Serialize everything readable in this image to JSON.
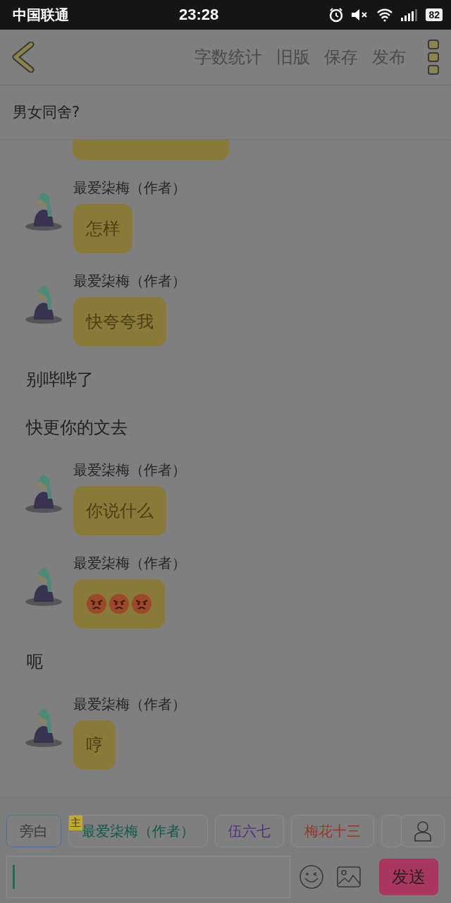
{
  "status_bar": {
    "carrier": "中国联通",
    "time": "23:28",
    "battery": "82"
  },
  "toolbar": {
    "actions": [
      "字数统计",
      "旧版",
      "保存",
      "发布"
    ]
  },
  "chapter_title": "男女同舍?",
  "messages": [
    {
      "kind": "partial"
    },
    {
      "kind": "author",
      "name": "最爱柒梅（作者）",
      "text": "怎样"
    },
    {
      "kind": "author",
      "name": "最爱柒梅（作者）",
      "text": "快夸夸我"
    },
    {
      "kind": "narration",
      "text": "别哔哔了"
    },
    {
      "kind": "narration",
      "text": "快更你的文去"
    },
    {
      "kind": "author",
      "name": "最爱柒梅（作者）",
      "text": "你说什么"
    },
    {
      "kind": "emoji",
      "name": "最爱柒梅（作者）"
    },
    {
      "kind": "narration",
      "text": "呃"
    },
    {
      "kind": "author",
      "name": "最爱柒梅（作者）",
      "text": "哼"
    }
  ],
  "roles": [
    {
      "label": "旁白",
      "selected": true,
      "color": "#3a3a3a"
    },
    {
      "label": "最爱柒梅（作者）",
      "selected": false,
      "color": "#0f5c4c",
      "badge": "主"
    },
    {
      "label": "伍六七",
      "selected": false,
      "color": "#4e2f78"
    },
    {
      "label": "梅花十三",
      "selected": false,
      "color": "#9a3426"
    },
    {
      "kind": "partial",
      "selected": false
    }
  ],
  "composer": {
    "send": "发送"
  }
}
